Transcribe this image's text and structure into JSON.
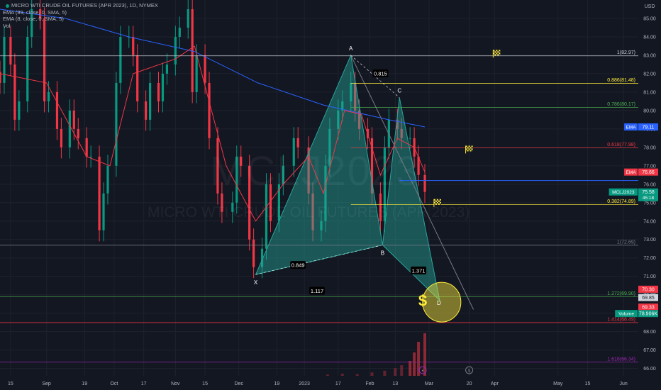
{
  "legend": {
    "symbol": "MICRO WTI CRUDE OIL FUTURES (APR 2023), 1D, NYMEX",
    "ema_slow": "EMA (89, close, 0, SMA, 5)",
    "ema_fast": "EMA (8, close, 0, SMA, 5)",
    "vol": "Vol"
  },
  "watermark": {
    "ticker": "MCLJ2023",
    "name": "MICRO WTI CRUDE OIL FUTURES (APR 2023)"
  },
  "colors": {
    "bg": "#131722",
    "up": "#089981",
    "down": "#f23645",
    "ema_fast": "#f23645",
    "ema_slow": "#2962ff",
    "harmonic": "#26a69a",
    "fib_yellow": "#ffeb3b",
    "fib_green": "#4caf50",
    "fib_red": "#f23645",
    "fib_purple": "#9c27b0",
    "fib_white": "#d1d4dc",
    "grid": "#1e222d"
  },
  "chart_data": {
    "type": "candlestick",
    "title": "",
    "y_axis": {
      "unit_label": "USD",
      "range": [
        65.6,
        86.0
      ],
      "ticks": [
        66,
        67,
        68,
        69,
        70,
        71,
        72,
        73,
        74,
        75,
        76,
        77,
        78,
        79,
        80,
        81,
        82,
        83,
        84,
        85
      ]
    },
    "x_axis": {
      "range": [
        "2022-08-10",
        "2023-06-08"
      ],
      "ticks": [
        {
          "date": "2022-08-15",
          "label": "15"
        },
        {
          "date": "2022-09-01",
          "label": "Sep"
        },
        {
          "date": "2022-09-19",
          "label": "19"
        },
        {
          "date": "2022-10-03",
          "label": "Oct"
        },
        {
          "date": "2022-10-17",
          "label": "17"
        },
        {
          "date": "2022-11-01",
          "label": "Nov"
        },
        {
          "date": "2022-11-15",
          "label": "15"
        },
        {
          "date": "2022-12-01",
          "label": "Dec"
        },
        {
          "date": "2022-12-19",
          "label": "19"
        },
        {
          "date": "2023-01-01",
          "label": "2023"
        },
        {
          "date": "2023-01-17",
          "label": "17"
        },
        {
          "date": "2023-02-01",
          "label": "Feb"
        },
        {
          "date": "2023-02-13",
          "label": "13"
        },
        {
          "date": "2023-03-01",
          "label": "Mar"
        },
        {
          "date": "2023-03-20",
          "label": "20"
        },
        {
          "date": "2023-04-01",
          "label": "Apr"
        },
        {
          "date": "2023-05-01",
          "label": "May"
        },
        {
          "date": "2023-05-15",
          "label": "15"
        },
        {
          "date": "2023-06-01",
          "label": "Jun"
        }
      ]
    },
    "candles_close": [
      {
        "date": "2022-08-10",
        "close": 81.5
      },
      {
        "date": "2022-08-12",
        "close": 84.0
      },
      {
        "date": "2022-08-15",
        "close": 82.5
      },
      {
        "date": "2022-08-17",
        "close": 79.5
      },
      {
        "date": "2022-08-19",
        "close": 80.5
      },
      {
        "date": "2022-08-23",
        "close": 84.0
      },
      {
        "date": "2022-08-25",
        "close": 85.5
      },
      {
        "date": "2022-08-29",
        "close": 85.0
      },
      {
        "date": "2022-08-31",
        "close": 80.5
      },
      {
        "date": "2022-09-02",
        "close": 81.0
      },
      {
        "date": "2022-09-06",
        "close": 79.0
      },
      {
        "date": "2022-09-08",
        "close": 78.0
      },
      {
        "date": "2022-09-12",
        "close": 80.0
      },
      {
        "date": "2022-09-14",
        "close": 79.0
      },
      {
        "date": "2022-09-16",
        "close": 78.5
      },
      {
        "date": "2022-09-20",
        "close": 77.5
      },
      {
        "date": "2022-09-22",
        "close": 77.5
      },
      {
        "date": "2022-09-26",
        "close": 73.5
      },
      {
        "date": "2022-09-28",
        "close": 75.5
      },
      {
        "date": "2022-09-30",
        "close": 77.0
      },
      {
        "date": "2022-10-04",
        "close": 81.5
      },
      {
        "date": "2022-10-06",
        "close": 84.0
      },
      {
        "date": "2022-10-10",
        "close": 84.0
      },
      {
        "date": "2022-10-12",
        "close": 83.0
      },
      {
        "date": "2022-10-14",
        "close": 80.5
      },
      {
        "date": "2022-10-18",
        "close": 79.5
      },
      {
        "date": "2022-10-20",
        "close": 81.5
      },
      {
        "date": "2022-10-24",
        "close": 80.5
      },
      {
        "date": "2022-10-26",
        "close": 82.0
      },
      {
        "date": "2022-10-28",
        "close": 82.5
      },
      {
        "date": "2022-11-01",
        "close": 84.0
      },
      {
        "date": "2022-11-03",
        "close": 84.5
      },
      {
        "date": "2022-11-07",
        "close": 85.5
      },
      {
        "date": "2022-11-09",
        "close": 81.0
      },
      {
        "date": "2022-11-11",
        "close": 83.0
      },
      {
        "date": "2022-11-15",
        "close": 81.5
      },
      {
        "date": "2022-11-17",
        "close": 78.5
      },
      {
        "date": "2022-11-21",
        "close": 75.5
      },
      {
        "date": "2022-11-23",
        "close": 74.5
      },
      {
        "date": "2022-11-28",
        "close": 75.0
      },
      {
        "date": "2022-11-30",
        "close": 77.5
      },
      {
        "date": "2022-12-02",
        "close": 77.0
      },
      {
        "date": "2022-12-06",
        "close": 73.0
      },
      {
        "date": "2022-12-08",
        "close": 71.5
      },
      {
        "date": "2022-12-12",
        "close": 72.5
      },
      {
        "date": "2022-12-14",
        "close": 76.0
      },
      {
        "date": "2022-12-16",
        "close": 74.0
      },
      {
        "date": "2022-12-20",
        "close": 76.0
      },
      {
        "date": "2022-12-22",
        "close": 77.0
      },
      {
        "date": "2022-12-27",
        "close": 78.5
      },
      {
        "date": "2022-12-29",
        "close": 78.0
      },
      {
        "date": "2023-01-03",
        "close": 75.5
      },
      {
        "date": "2023-01-05",
        "close": 73.5
      },
      {
        "date": "2023-01-09",
        "close": 74.0
      },
      {
        "date": "2023-01-11",
        "close": 77.0
      },
      {
        "date": "2023-01-13",
        "close": 79.0
      },
      {
        "date": "2023-01-17",
        "close": 80.0
      },
      {
        "date": "2023-01-19",
        "close": 80.5
      },
      {
        "date": "2023-01-23",
        "close": 81.5
      },
      {
        "date": "2023-01-25",
        "close": 80.0
      },
      {
        "date": "2023-01-27",
        "close": 79.0
      },
      {
        "date": "2023-01-31",
        "close": 78.5
      },
      {
        "date": "2023-02-02",
        "close": 75.5
      },
      {
        "date": "2023-02-06",
        "close": 74.0
      },
      {
        "date": "2023-02-08",
        "close": 78.0
      },
      {
        "date": "2023-02-10",
        "close": 79.5
      },
      {
        "date": "2023-02-14",
        "close": 79.0
      },
      {
        "date": "2023-02-16",
        "close": 78.5
      },
      {
        "date": "2023-02-20",
        "close": 78.5
      },
      {
        "date": "2023-02-22",
        "close": 77.5
      },
      {
        "date": "2023-02-24",
        "close": 76.5
      },
      {
        "date": "2023-02-27",
        "close": 75.58
      }
    ],
    "volume": [
      {
        "date": "2023-01-12",
        "v": 0.03
      },
      {
        "date": "2023-01-19",
        "v": 0.05
      },
      {
        "date": "2023-01-26",
        "v": 0.04
      },
      {
        "date": "2023-02-02",
        "v": 0.08
      },
      {
        "date": "2023-02-08",
        "v": 0.12
      },
      {
        "date": "2023-02-13",
        "v": 0.18
      },
      {
        "date": "2023-02-16",
        "v": 0.25
      },
      {
        "date": "2023-02-20",
        "v": 0.35
      },
      {
        "date": "2023-02-22",
        "v": 0.55
      },
      {
        "date": "2023-02-24",
        "v": 0.8
      },
      {
        "date": "2023-02-27",
        "v": 1.0
      }
    ],
    "ema_fast_close": [
      {
        "date": "2022-08-10",
        "value": 82.0
      },
      {
        "date": "2022-09-01",
        "value": 81.5
      },
      {
        "date": "2022-09-20",
        "value": 77.5
      },
      {
        "date": "2022-10-01",
        "value": 77.0
      },
      {
        "date": "2022-10-12",
        "value": 82.0
      },
      {
        "date": "2022-11-01",
        "value": 82.8
      },
      {
        "date": "2022-11-10",
        "value": 83.5
      },
      {
        "date": "2022-11-25",
        "value": 77.0
      },
      {
        "date": "2022-12-09",
        "value": 74.0
      },
      {
        "date": "2022-12-22",
        "value": 76.0
      },
      {
        "date": "2023-01-03",
        "value": 77.5
      },
      {
        "date": "2023-01-10",
        "value": 75.5
      },
      {
        "date": "2023-01-20",
        "value": 80.0
      },
      {
        "date": "2023-01-28",
        "value": 79.8
      },
      {
        "date": "2023-02-06",
        "value": 76.5
      },
      {
        "date": "2023-02-14",
        "value": 78.5
      },
      {
        "date": "2023-02-22",
        "value": 78.0
      },
      {
        "date": "2023-02-27",
        "value": 76.66
      }
    ],
    "ema_slow_close": [
      {
        "date": "2022-08-10",
        "value": 85.5
      },
      {
        "date": "2022-09-10",
        "value": 85.0
      },
      {
        "date": "2022-10-10",
        "value": 84.0
      },
      {
        "date": "2022-11-10",
        "value": 83.2
      },
      {
        "date": "2022-12-10",
        "value": 81.5
      },
      {
        "date": "2023-01-10",
        "value": 80.3
      },
      {
        "date": "2023-02-10",
        "value": 79.5
      },
      {
        "date": "2023-02-27",
        "value": 79.11
      }
    ],
    "harmonic_pattern": {
      "points": [
        {
          "label": "X",
          "date": "2022-12-09",
          "price": 71.1
        },
        {
          "label": "A",
          "date": "2023-01-23",
          "price": 83.0
        },
        {
          "label": "B",
          "date": "2023-02-07",
          "price": 72.7
        },
        {
          "label": "C",
          "date": "2023-02-15",
          "price": 80.7
        },
        {
          "label": "D",
          "date": "2023-03-06",
          "price": 69.7
        }
      ],
      "ratios": [
        {
          "label": "0.815",
          "date": "2023-02-06",
          "price": 82.0
        },
        {
          "label": "0.849",
          "date": "2022-12-29",
          "price": 71.6
        },
        {
          "label": "1.371",
          "date": "2023-02-24",
          "price": 71.3
        },
        {
          "label": "1.117",
          "date": "2023-01-07",
          "price": 70.2
        }
      ]
    },
    "fib_levels": [
      {
        "ratio": "1",
        "price": 82.97,
        "label": "1(82.97)",
        "color": "#d1d4dc"
      },
      {
        "ratio": "0.886",
        "price": 81.48,
        "label": "0.886(81.48)",
        "color": "#ffeb3b"
      },
      {
        "ratio": "0.786",
        "price": 80.17,
        "label": "0.786(80.17)",
        "color": "#4caf50"
      },
      {
        "ratio": "0.618",
        "price": 77.98,
        "label": "0.618(77.98)",
        "color": "#f23645"
      },
      {
        "ratio": "0.382",
        "price": 74.89,
        "label": "0.382(74.89)",
        "color": "#ffeb3b"
      },
      {
        "ratio": "1",
        "price": 72.69,
        "label": "1(72.69)",
        "color": "#787b86"
      },
      {
        "ratio": "1.272",
        "price": 69.9,
        "label": "1.272(69.90)",
        "color": "#4caf50"
      },
      {
        "ratio": "1.414",
        "price": 68.49,
        "label": "1.414(68.49)",
        "color": "#f23645"
      },
      {
        "ratio": "1.618",
        "price": 66.34,
        "label": "1.618(66.34)",
        "color": "#9c27b0"
      }
    ],
    "price_tags": [
      {
        "label": "EMA",
        "value": "79.11",
        "price": 79.11,
        "color": "#2962ff"
      },
      {
        "label": "EMA",
        "value": "76.66",
        "price": 76.66,
        "color": "#f23645"
      },
      {
        "label": "MCLJ2023",
        "value": "75.58",
        "sub": "45:18",
        "price": 75.58,
        "color": "#089981"
      },
      {
        "label": "",
        "value": "70.30",
        "price": 70.3,
        "color": "#f23645"
      },
      {
        "label": "",
        "value": "69.85",
        "price": 69.85,
        "color": "#d1d4dc"
      },
      {
        "label": "",
        "value": "69.33",
        "price": 69.33,
        "color": "#f23645"
      },
      {
        "label": "Volume",
        "value": "78.906K",
        "price": 68.98,
        "color": "#089981"
      }
    ],
    "flags": [
      {
        "date": "2023-04-02",
        "price": 83.1
      },
      {
        "date": "2023-03-20",
        "price": 77.9
      },
      {
        "date": "2023-03-05",
        "price": 75.0
      }
    ],
    "dollar_marker": {
      "text": "$",
      "date": "2023-02-26",
      "price": 69.7
    },
    "d_zone": {
      "date": "2023-03-07",
      "price": 69.6
    }
  }
}
